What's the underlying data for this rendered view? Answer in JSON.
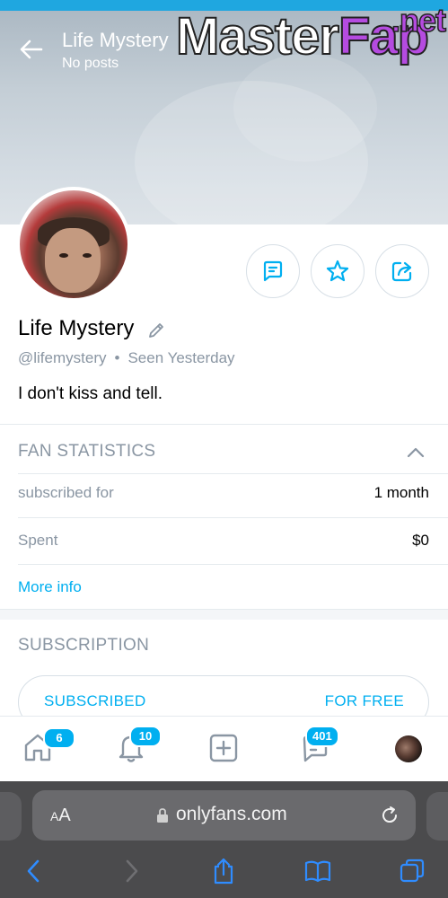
{
  "header": {
    "title": "Life Mystery",
    "subtitle": "No posts"
  },
  "watermark": {
    "part1": "Master",
    "part2": "Fap",
    "part3": ".net"
  },
  "profile": {
    "name": "Life Mystery",
    "handle": "@lifemystery",
    "separator": "•",
    "last_seen": "Seen Yesterday",
    "bio": "I don't kiss and tell."
  },
  "fan_statistics": {
    "title": "FAN STATISTICS",
    "rows": [
      {
        "label": "subscribed for",
        "value": "1 month"
      },
      {
        "label": "Spent",
        "value": "$0"
      }
    ],
    "more_info": "More info"
  },
  "subscription": {
    "title": "SUBSCRIPTION",
    "status": "SUBSCRIBED",
    "price": "FOR FREE"
  },
  "bottom_nav": {
    "home_badge": "6",
    "notifications_badge": "10",
    "messages_badge": "401"
  },
  "browser": {
    "text_size_label_small": "A",
    "text_size_label_large": "A",
    "url": "onlyfans.com"
  },
  "colors": {
    "accent": "#00aff0",
    "muted_text": "#8a96a3",
    "divider": "#e5eaee",
    "watermark_purple": "#b54be0"
  }
}
